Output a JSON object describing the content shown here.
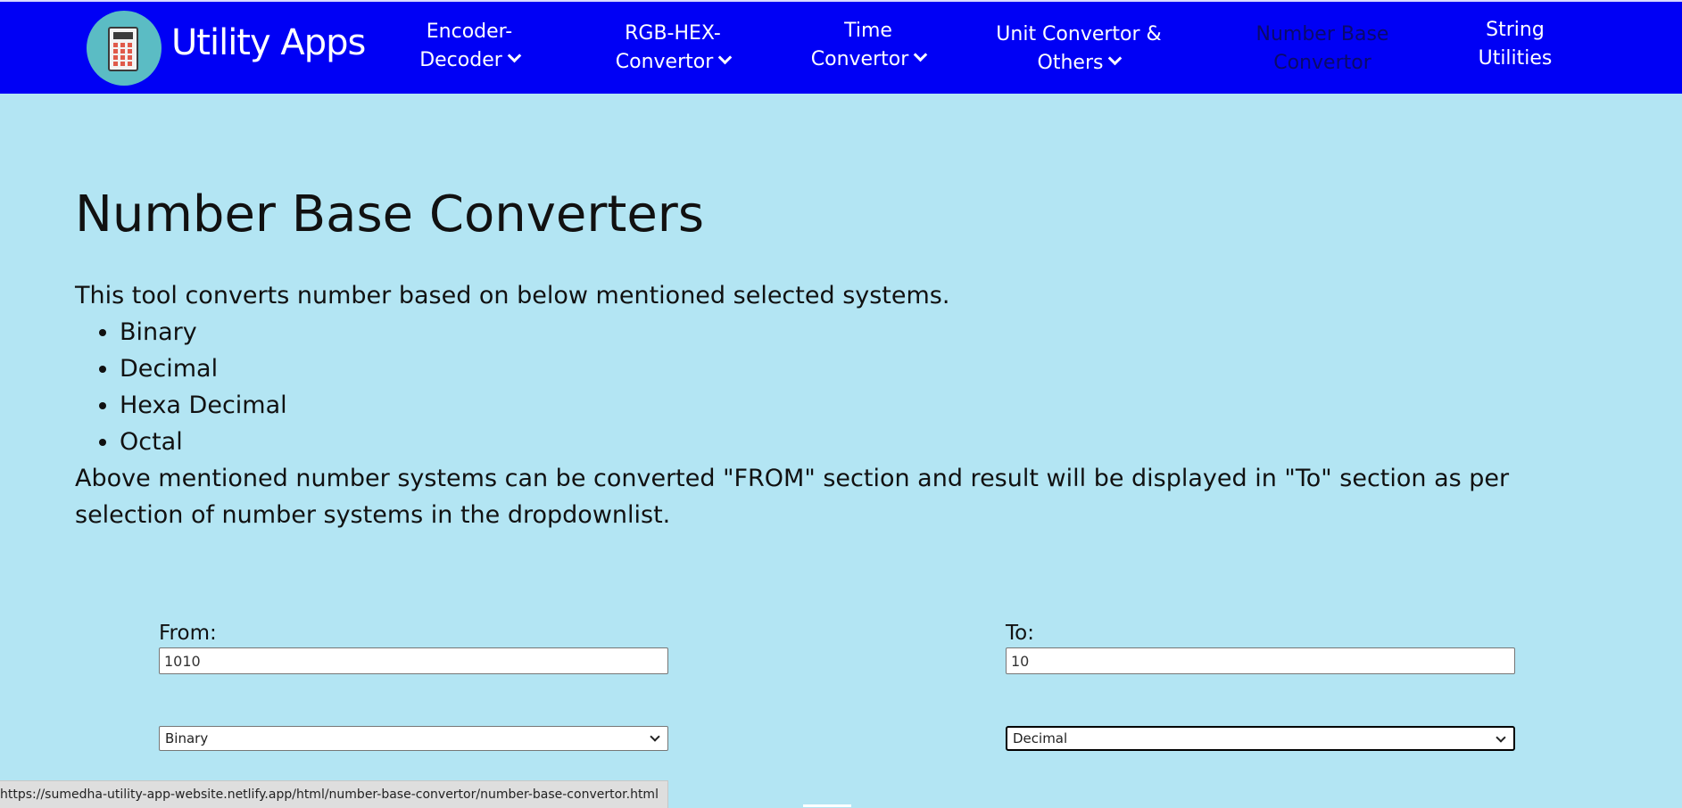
{
  "brand": {
    "name": "Utility Apps",
    "logo_icon": "calculator-icon"
  },
  "nav": {
    "items": [
      {
        "line1": "Encoder-",
        "line2": "Decoder",
        "dropdown": true
      },
      {
        "line1": "RGB-HEX-",
        "line2": "Convertor",
        "dropdown": true
      },
      {
        "line1": "Time",
        "line2": "Convertor",
        "dropdown": true
      },
      {
        "line1": "Unit Convertor &",
        "line2": "Others",
        "dropdown": true
      },
      {
        "line1": "Number Base",
        "line2": "Convertor",
        "dropdown": false,
        "active": true
      },
      {
        "line1": "String",
        "line2": "Utilities",
        "dropdown": false
      }
    ]
  },
  "main": {
    "title": "Number Base Converters",
    "intro": "This tool converts number based on below mentioned selected systems.",
    "systems": [
      "Binary",
      "Decimal",
      "Hexa Decimal",
      "Octal"
    ],
    "outro": "Above mentioned number systems can be converted \"FROM\" section and result will be displayed in \"To\" section as per selection of number systems in the dropdownlist."
  },
  "converter": {
    "from_label": "From:",
    "from_value": "1010",
    "from_system": "Binary",
    "to_label": "To:",
    "to_value": "10",
    "to_system": "Decimal"
  },
  "status_bar": {
    "url": "https://sumedha-utility-app-website.netlify.app/html/number-base-convertor/number-base-convertor.html"
  },
  "colors": {
    "navbar_bg": "#0000f5",
    "page_bg": "#b3e5f3",
    "nav_text": "#ffffff",
    "nav_active_text": "#0a0a6a"
  }
}
